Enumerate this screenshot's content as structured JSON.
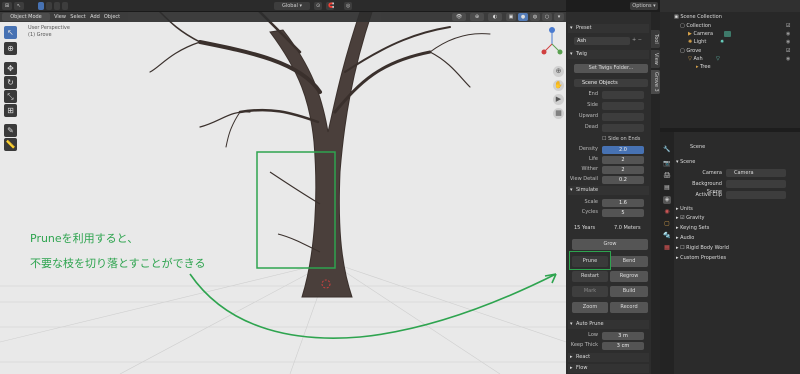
{
  "topbar": {
    "orientation": "Global",
    "options": "Options"
  },
  "viewport": {
    "mode": "Object Mode",
    "menu": [
      "View",
      "Select",
      "Add",
      "Object"
    ],
    "view_label": "User Perspective",
    "collection_label": "(1) Grove",
    "annotation_line1": "Pruneを利用すると、",
    "annotation_line2": "不要な枝を切り落とすことができる",
    "accent": "#2ea44f"
  },
  "npanel": {
    "preset_header": "Preset",
    "preset_value": "Ash",
    "twig_header": "Twig",
    "set_twigs": "Set Twigs Folder...",
    "scene_objects": "Scene Objects",
    "twig_fields": [
      "End",
      "Side",
      "Upward",
      "Dead"
    ],
    "side_on_ends": "Side on Ends",
    "density_label": "Density",
    "density": "2.0",
    "life_label": "Life",
    "life": "2",
    "wither_label": "Wither",
    "wither": "2",
    "view_detail_label": "View Detail",
    "view_detail": "0.2",
    "simulate_header": "Simulate",
    "scale_label": "Scale",
    "scale": "1.6",
    "cycles_label": "Cycles",
    "cycles": "5",
    "years": "15 Years",
    "meters": "7.0 Meters",
    "grow": "Grow",
    "prune": "Prune",
    "bend": "Bend",
    "restart": "Restart",
    "regrow": "Regrow",
    "mark": "Mark",
    "build": "Build",
    "zoom": "Zoom",
    "record": "Record",
    "auto_prune_header": "Auto Prune",
    "low_label": "Low",
    "low": "3 m",
    "keep_thick_label": "Keep Thick",
    "keep_thick": "3 cm",
    "react_header": "React",
    "flow_header": "Flow"
  },
  "vtabs": [
    "Tool",
    "View",
    "Grove 3"
  ],
  "outliner": {
    "rows": [
      {
        "label": "Scene Collection",
        "indent": 0,
        "icon": "scene-collection-icon"
      },
      {
        "label": "Collection",
        "indent": 1,
        "icon": "collection-icon"
      },
      {
        "label": "Camera",
        "indent": 2,
        "icon": "camera-icon"
      },
      {
        "label": "Light",
        "indent": 2,
        "icon": "light-icon"
      },
      {
        "label": "Grove",
        "indent": 1,
        "icon": "collection-icon"
      },
      {
        "label": "Ash",
        "indent": 2,
        "icon": "object-icon"
      },
      {
        "label": "Tree",
        "indent": 3,
        "icon": "mesh-icon"
      }
    ]
  },
  "properties": {
    "title": "Scene",
    "scene_header": "Scene",
    "camera_label": "Camera",
    "camera_value": "Camera",
    "bg_scene_label": "Background Scene",
    "active_clip_label": "Active Clip",
    "panels": [
      "Units",
      "Gravity",
      "Keying Sets",
      "Audio",
      "Rigid Body World",
      "Custom Properties"
    ]
  }
}
